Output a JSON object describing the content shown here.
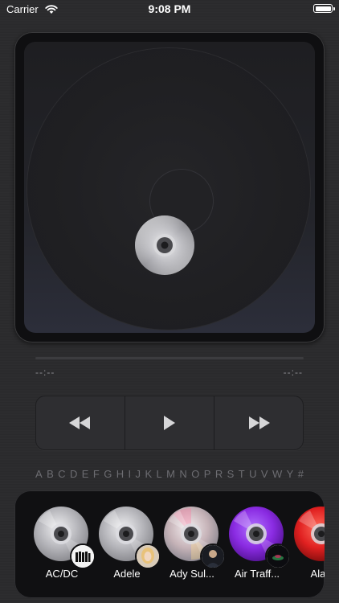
{
  "status_bar": {
    "carrier": "Carrier",
    "time": "9:08 PM",
    "battery_level": 1.0
  },
  "player": {
    "elapsed": "--:--",
    "remaining": "--:--",
    "progress": 0.0,
    "controls": [
      {
        "name": "rewind-button",
        "icon": "rewind-icon"
      },
      {
        "name": "play-button",
        "icon": "play-icon"
      },
      {
        "name": "fast-forward-button",
        "icon": "fast-forward-icon"
      }
    ]
  },
  "alphabet": [
    "A",
    "B",
    "C",
    "D",
    "E",
    "F",
    "G",
    "H",
    "I",
    "J",
    "K",
    "L",
    "M",
    "N",
    "O",
    "P",
    "R",
    "S",
    "T",
    "U",
    "V",
    "W",
    "Y",
    "#"
  ],
  "artists": [
    {
      "name": "AC/DC",
      "cd_style": "silver",
      "thumb": "band-photo"
    },
    {
      "name": "Adele",
      "cd_style": "silver",
      "thumb": "portrait-blonde"
    },
    {
      "name": "Ady Sul...",
      "cd_style": "silver-iridescent",
      "thumb": "portrait-dark"
    },
    {
      "name": "Air Traff...",
      "cd_style": "purple",
      "thumb": "album-art-dark"
    },
    {
      "name": "Alain",
      "cd_style": "red",
      "thumb": "none"
    }
  ],
  "colors": {
    "background": "#2b2b2d",
    "accent_purple": "#8a2be2",
    "accent_red": "#e02020",
    "text_secondary": "#8e8e93"
  }
}
